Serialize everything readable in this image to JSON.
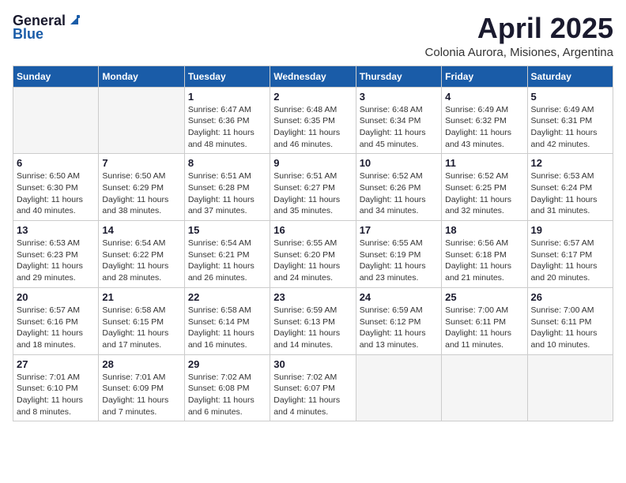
{
  "logo": {
    "general": "General",
    "blue": "Blue"
  },
  "header": {
    "month_year": "April 2025",
    "location": "Colonia Aurora, Misiones, Argentina"
  },
  "weekdays": [
    "Sunday",
    "Monday",
    "Tuesday",
    "Wednesday",
    "Thursday",
    "Friday",
    "Saturday"
  ],
  "weeks": [
    [
      {
        "day": "",
        "info": ""
      },
      {
        "day": "",
        "info": ""
      },
      {
        "day": "1",
        "info": "Sunrise: 6:47 AM\nSunset: 6:36 PM\nDaylight: 11 hours and 48 minutes."
      },
      {
        "day": "2",
        "info": "Sunrise: 6:48 AM\nSunset: 6:35 PM\nDaylight: 11 hours and 46 minutes."
      },
      {
        "day": "3",
        "info": "Sunrise: 6:48 AM\nSunset: 6:34 PM\nDaylight: 11 hours and 45 minutes."
      },
      {
        "day": "4",
        "info": "Sunrise: 6:49 AM\nSunset: 6:32 PM\nDaylight: 11 hours and 43 minutes."
      },
      {
        "day": "5",
        "info": "Sunrise: 6:49 AM\nSunset: 6:31 PM\nDaylight: 11 hours and 42 minutes."
      }
    ],
    [
      {
        "day": "6",
        "info": "Sunrise: 6:50 AM\nSunset: 6:30 PM\nDaylight: 11 hours and 40 minutes."
      },
      {
        "day": "7",
        "info": "Sunrise: 6:50 AM\nSunset: 6:29 PM\nDaylight: 11 hours and 38 minutes."
      },
      {
        "day": "8",
        "info": "Sunrise: 6:51 AM\nSunset: 6:28 PM\nDaylight: 11 hours and 37 minutes."
      },
      {
        "day": "9",
        "info": "Sunrise: 6:51 AM\nSunset: 6:27 PM\nDaylight: 11 hours and 35 minutes."
      },
      {
        "day": "10",
        "info": "Sunrise: 6:52 AM\nSunset: 6:26 PM\nDaylight: 11 hours and 34 minutes."
      },
      {
        "day": "11",
        "info": "Sunrise: 6:52 AM\nSunset: 6:25 PM\nDaylight: 11 hours and 32 minutes."
      },
      {
        "day": "12",
        "info": "Sunrise: 6:53 AM\nSunset: 6:24 PM\nDaylight: 11 hours and 31 minutes."
      }
    ],
    [
      {
        "day": "13",
        "info": "Sunrise: 6:53 AM\nSunset: 6:23 PM\nDaylight: 11 hours and 29 minutes."
      },
      {
        "day": "14",
        "info": "Sunrise: 6:54 AM\nSunset: 6:22 PM\nDaylight: 11 hours and 28 minutes."
      },
      {
        "day": "15",
        "info": "Sunrise: 6:54 AM\nSunset: 6:21 PM\nDaylight: 11 hours and 26 minutes."
      },
      {
        "day": "16",
        "info": "Sunrise: 6:55 AM\nSunset: 6:20 PM\nDaylight: 11 hours and 24 minutes."
      },
      {
        "day": "17",
        "info": "Sunrise: 6:55 AM\nSunset: 6:19 PM\nDaylight: 11 hours and 23 minutes."
      },
      {
        "day": "18",
        "info": "Sunrise: 6:56 AM\nSunset: 6:18 PM\nDaylight: 11 hours and 21 minutes."
      },
      {
        "day": "19",
        "info": "Sunrise: 6:57 AM\nSunset: 6:17 PM\nDaylight: 11 hours and 20 minutes."
      }
    ],
    [
      {
        "day": "20",
        "info": "Sunrise: 6:57 AM\nSunset: 6:16 PM\nDaylight: 11 hours and 18 minutes."
      },
      {
        "day": "21",
        "info": "Sunrise: 6:58 AM\nSunset: 6:15 PM\nDaylight: 11 hours and 17 minutes."
      },
      {
        "day": "22",
        "info": "Sunrise: 6:58 AM\nSunset: 6:14 PM\nDaylight: 11 hours and 16 minutes."
      },
      {
        "day": "23",
        "info": "Sunrise: 6:59 AM\nSunset: 6:13 PM\nDaylight: 11 hours and 14 minutes."
      },
      {
        "day": "24",
        "info": "Sunrise: 6:59 AM\nSunset: 6:12 PM\nDaylight: 11 hours and 13 minutes."
      },
      {
        "day": "25",
        "info": "Sunrise: 7:00 AM\nSunset: 6:11 PM\nDaylight: 11 hours and 11 minutes."
      },
      {
        "day": "26",
        "info": "Sunrise: 7:00 AM\nSunset: 6:11 PM\nDaylight: 11 hours and 10 minutes."
      }
    ],
    [
      {
        "day": "27",
        "info": "Sunrise: 7:01 AM\nSunset: 6:10 PM\nDaylight: 11 hours and 8 minutes."
      },
      {
        "day": "28",
        "info": "Sunrise: 7:01 AM\nSunset: 6:09 PM\nDaylight: 11 hours and 7 minutes."
      },
      {
        "day": "29",
        "info": "Sunrise: 7:02 AM\nSunset: 6:08 PM\nDaylight: 11 hours and 6 minutes."
      },
      {
        "day": "30",
        "info": "Sunrise: 7:02 AM\nSunset: 6:07 PM\nDaylight: 11 hours and 4 minutes."
      },
      {
        "day": "",
        "info": ""
      },
      {
        "day": "",
        "info": ""
      },
      {
        "day": "",
        "info": ""
      }
    ]
  ]
}
